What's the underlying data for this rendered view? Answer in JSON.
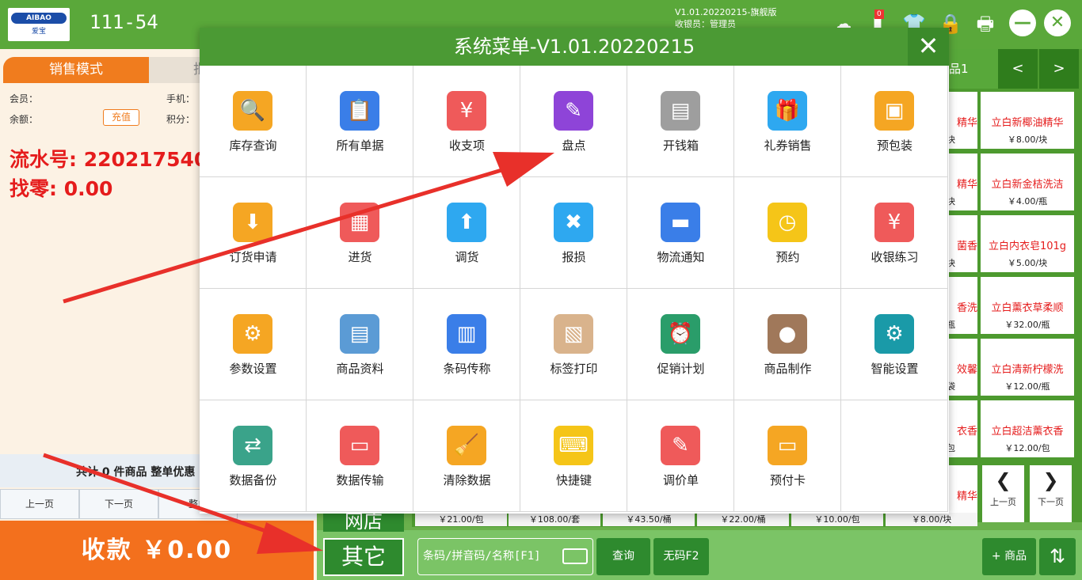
{
  "topbar": {
    "logo_text": "AIBAO",
    "logo_sub": "爱宝",
    "station": "111-54",
    "version": "V1.01.20220215-旗舰版",
    "cashier": "收银员：管理员",
    "badge": "0"
  },
  "left": {
    "tab_sales": "销售模式",
    "tab_other": "批",
    "member_label": "会员：",
    "phone_label": "手机：",
    "balance_label": "余额：",
    "recharge": "充值",
    "points_label": "积分：",
    "serial": "流水号: 220217540",
    "change": "找零: 0.00",
    "summary": "共计 0 件商品 整单优惠",
    "prev_page": "上一页",
    "next_page": "下一页",
    "whole": "整单",
    "pay": "收款   ￥0.00"
  },
  "right": {
    "category": "品1",
    "prev": "<",
    "next": ">",
    "partials": [
      {
        "name": "精华",
        "price": "块"
      },
      {
        "name": "精华",
        "price": "块"
      },
      {
        "name": "菌香",
        "price": "块"
      },
      {
        "name": "香洗",
        "price": "瓶"
      },
      {
        "name": "效馨",
        "price": "袋"
      },
      {
        "name": "衣香",
        "price": "包"
      },
      {
        "name": "精华",
        "price": ""
      }
    ],
    "products": [
      {
        "name": "立白新椰油精华",
        "price": "￥8.00/块"
      },
      {
        "name": "立白新金桔洗洁",
        "price": "￥4.00/瓶"
      },
      {
        "name": "立白内衣皂101g",
        "price": "￥5.00/块"
      },
      {
        "name": "立白薰衣草柔顺",
        "price": "￥32.00/瓶"
      },
      {
        "name": "立白清新柠檬洗",
        "price": "￥12.00/瓶"
      },
      {
        "name": "立白超洁薰衣香",
        "price": "￥12.00/包"
      }
    ],
    "page_prev": "上一页",
    "page_next": "下一页"
  },
  "price_strip": [
    "￥21.00/包",
    "￥108.00/套",
    "￥43.50/桶",
    "￥22.00/桶",
    "￥10.00/包",
    "￥8.00/块"
  ],
  "bottom": {
    "netstore": "网店",
    "other": "其它",
    "search_placeholder": "条码/拼音码/名称[F1]",
    "query": "查询",
    "no_code": "无码F2",
    "add_product": "+ 商品",
    "swap": "⇅"
  },
  "modal": {
    "title": "系统菜单-V1.01.20220215",
    "close": "✕",
    "items": [
      {
        "label": "库存查询",
        "icon": "inventory-search-icon",
        "glyph": "🔍",
        "color": "#f5a623"
      },
      {
        "label": "所有单据",
        "icon": "documents-icon",
        "glyph": "📋",
        "color": "#3a7ee8"
      },
      {
        "label": "收支项",
        "icon": "income-expense-icon",
        "glyph": "¥",
        "color": "#ef5a5a"
      },
      {
        "label": "盘点",
        "icon": "stocktake-icon",
        "glyph": "✎",
        "color": "#8e44d8"
      },
      {
        "label": "开钱箱",
        "icon": "cash-drawer-icon",
        "glyph": "▤",
        "color": "#9e9e9e"
      },
      {
        "label": "礼券销售",
        "icon": "gift-coupon-icon",
        "glyph": "🎁",
        "color": "#2ea8f0"
      },
      {
        "label": "预包装",
        "icon": "prepackage-icon",
        "glyph": "▣",
        "color": "#f5a623"
      },
      {
        "label": "订货申请",
        "icon": "order-request-icon",
        "glyph": "⬇",
        "color": "#f5a623"
      },
      {
        "label": "进货",
        "icon": "purchase-icon",
        "glyph": "▦",
        "color": "#ef5a5a"
      },
      {
        "label": "调货",
        "icon": "transfer-icon",
        "glyph": "⬆",
        "color": "#2ea8f0"
      },
      {
        "label": "报损",
        "icon": "damage-report-icon",
        "glyph": "✖",
        "color": "#2ea8f0"
      },
      {
        "label": "物流通知",
        "icon": "logistics-truck-icon",
        "glyph": "▬",
        "color": "#3a7ee8"
      },
      {
        "label": "预约",
        "icon": "appointment-calendar-icon",
        "glyph": "◷",
        "color": "#f5c518"
      },
      {
        "label": "收银练习",
        "icon": "cashier-practice-icon",
        "glyph": "¥",
        "color": "#ef5a5a"
      },
      {
        "label": "参数设置",
        "icon": "parameter-gears-icon",
        "glyph": "⚙",
        "color": "#f5a623"
      },
      {
        "label": "商品资料",
        "icon": "product-info-icon",
        "glyph": "▤",
        "color": "#5b9bd5"
      },
      {
        "label": "条码传称",
        "icon": "barcode-scale-icon",
        "glyph": "▥",
        "color": "#3a7ee8"
      },
      {
        "label": "标签打印",
        "icon": "label-print-icon",
        "glyph": "▧",
        "color": "#d9b38c"
      },
      {
        "label": "促销计划",
        "icon": "promotion-clock-icon",
        "glyph": "⏰",
        "color": "#2a9d6a"
      },
      {
        "label": "商品制作",
        "icon": "product-bowl-icon",
        "glyph": "●",
        "color": "#a0785a"
      },
      {
        "label": "智能设置",
        "icon": "smart-settings-gear-icon",
        "glyph": "⚙",
        "color": "#1a9aa8"
      },
      {
        "label": "数据备份",
        "icon": "data-backup-icon",
        "glyph": "⇄",
        "color": "#3aa38a"
      },
      {
        "label": "数据传输",
        "icon": "data-transfer-icon",
        "glyph": "▭",
        "color": "#ef5a5a"
      },
      {
        "label": "清除数据",
        "icon": "clear-data-broom-icon",
        "glyph": "🧹",
        "color": "#f5a623"
      },
      {
        "label": "快捷键",
        "icon": "shortcut-keyboard-icon",
        "glyph": "⌨",
        "color": "#f5c518"
      },
      {
        "label": "调价单",
        "icon": "price-adjust-icon",
        "glyph": "✎",
        "color": "#ef5a5a"
      },
      {
        "label": "预付卡",
        "icon": "prepaid-card-icon",
        "glyph": "▭",
        "color": "#f5a623"
      }
    ]
  },
  "colors": {
    "green": "#5aa83a",
    "dark_green": "#2e8a2e",
    "orange": "#f3701d",
    "red_text": "#e51c1c",
    "arrow_red": "#e8302a"
  }
}
